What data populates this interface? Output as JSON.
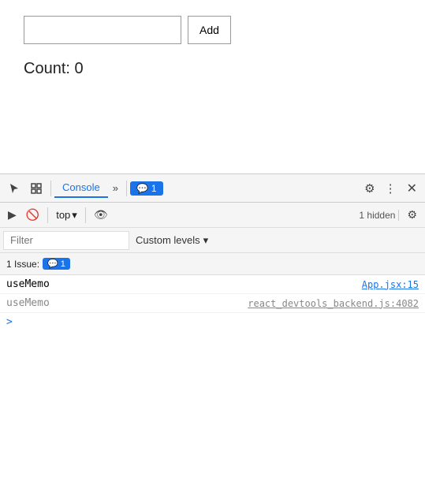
{
  "app": {
    "input_placeholder": "",
    "add_button_label": "Add",
    "count_label": "Count: 0"
  },
  "devtools": {
    "tab_console": "Console",
    "tab_more_icon": "»",
    "badge_count": "1",
    "badge_icon": "💬",
    "gear_icon": "⚙",
    "dots_icon": "⋮",
    "close_icon": "✕",
    "play_icon": "▶",
    "no_entry_icon": "🚫",
    "top_label": "top",
    "top_arrow": "▾",
    "eye_icon": "👁",
    "hidden_label": "1 hidden",
    "settings_icon": "⚙",
    "filter_placeholder": "Filter",
    "custom_levels_label": "Custom levels",
    "custom_levels_arrow": "▾",
    "issues_label": "1 Issue:",
    "issues_badge_icon": "💬",
    "issues_badge_count": "1",
    "log_rows": [
      {
        "text": "useMemo",
        "filename": "App.jsx:15",
        "type": "normal"
      },
      {
        "text": "useMemo",
        "filename": "react_devtools_backend.js:4082",
        "type": "gray"
      }
    ],
    "cursor_symbol": ">"
  }
}
